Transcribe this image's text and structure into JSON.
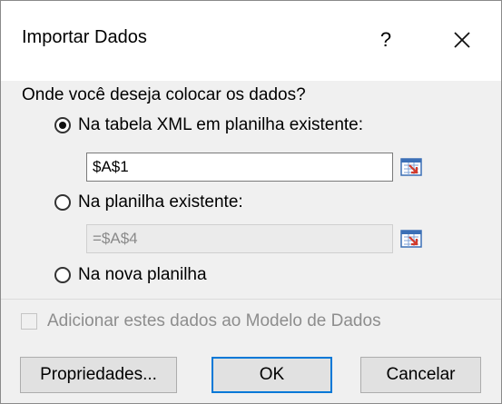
{
  "dialog": {
    "title": "Importar Dados",
    "help_label": "?",
    "question": "Onde você deseja colocar os dados?",
    "options": [
      {
        "label": "Na tabela XML em planilha existente:",
        "selected": true,
        "value": "$A$1"
      },
      {
        "label": "Na planilha existente:",
        "selected": false,
        "value": "=$A$4"
      },
      {
        "label": "Na nova planilha",
        "selected": false
      }
    ],
    "data_model_checkbox": {
      "label": "Adicionar estes dados ao Modelo de Dados",
      "checked": false,
      "enabled": false
    },
    "buttons": {
      "properties": "Propriedades...",
      "ok": "OK",
      "cancel": "Cancelar"
    },
    "icons": {
      "close": "close-icon",
      "collapse": "collapse-dialog-icon"
    },
    "colors": {
      "accent": "#0078d7",
      "background": "#f0f0f0"
    }
  }
}
